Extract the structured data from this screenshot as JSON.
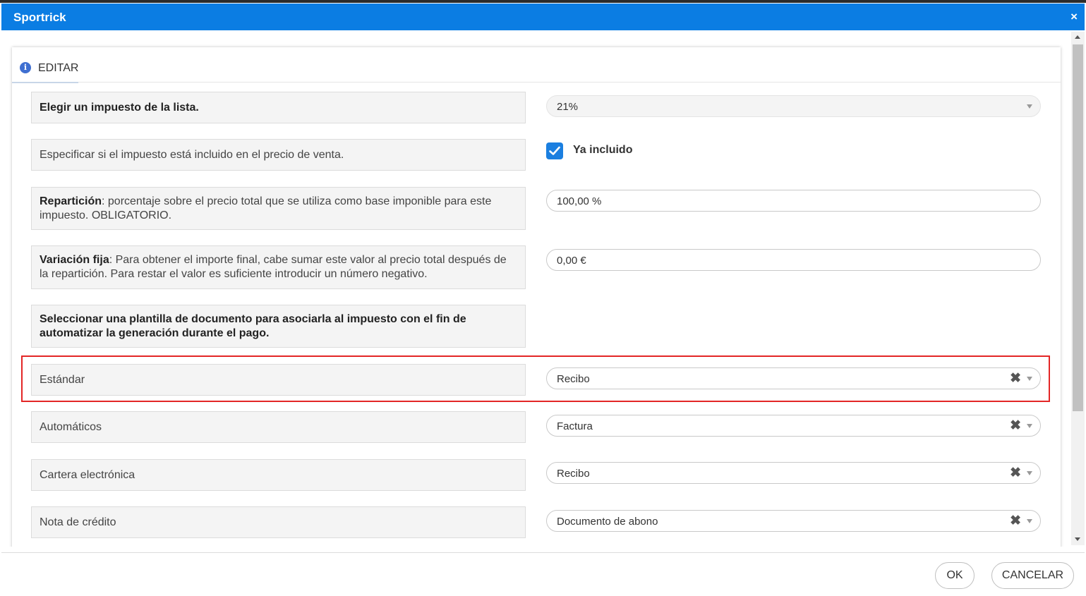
{
  "window": {
    "title": "Sportrick",
    "close_icon": "×"
  },
  "tab": {
    "label": "EDITAR",
    "icon": "info-icon",
    "icon_glyph": "i"
  },
  "tax_select": {
    "label": "Elegir un impuesto de la lista.",
    "value": "21%"
  },
  "included": {
    "description": "Especificar si el impuesto está incluido en el precio de venta.",
    "checkbox_label": "Ya incluido",
    "checked": true
  },
  "reparticion": {
    "label_bold": "Repartición",
    "label_rest": ": porcentaje sobre el precio total que se utiliza como base imponible para este impuesto. OBLIGATORIO.",
    "value": "100,00 %"
  },
  "variacion": {
    "label_bold": "Variación fija",
    "label_rest": ": Para obtener el importe final, cabe sumar este valor al precio total después de la repartición. Para restar el valor es suficiente introducir un número negativo.",
    "value": "0,00 €"
  },
  "template_heading": "Seleccionar una plantilla de documento para asociarla al impuesto con el fin de automatizar la generación durante el pago.",
  "templates": [
    {
      "label": "Estándar",
      "value": "Recibo",
      "highlighted": true
    },
    {
      "label": "Automáticos",
      "value": "Factura"
    },
    {
      "label": "Cartera electrónica",
      "value": "Recibo"
    },
    {
      "label": "Nota de crédito",
      "value": "Documento de abono"
    }
  ],
  "clear_glyph": "✖",
  "footer": {
    "ok": "OK",
    "cancel": "CANCELAR"
  },
  "colors": {
    "titlebar": "#0b7de3",
    "checkbox": "#1b7fe0",
    "highlight": "#e32626"
  }
}
